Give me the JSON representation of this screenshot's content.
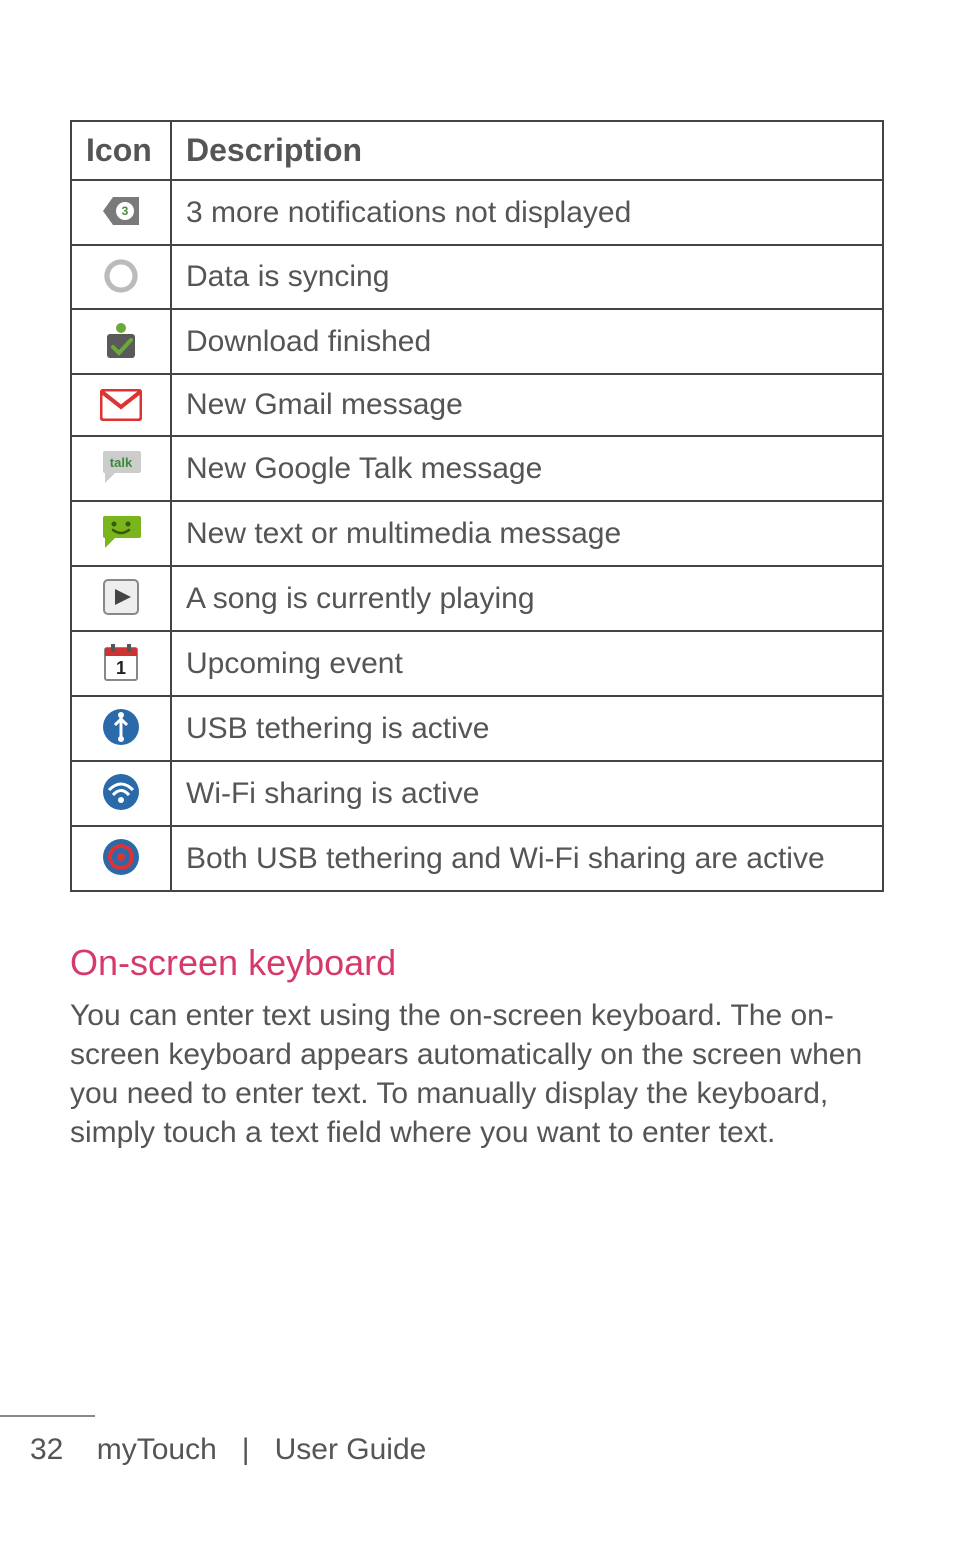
{
  "table": {
    "headers": {
      "icon": "Icon",
      "description": "Description"
    },
    "rows": [
      {
        "icon_name": "more-notifications-icon",
        "description": "3 more notifications not displayed"
      },
      {
        "icon_name": "sync-icon",
        "description": "Data is syncing"
      },
      {
        "icon_name": "download-finished-icon",
        "description": "Download finished"
      },
      {
        "icon_name": "gmail-icon",
        "description": "New Gmail message"
      },
      {
        "icon_name": "google-talk-icon",
        "description": "New Google Talk message"
      },
      {
        "icon_name": "sms-mms-icon",
        "description": "New text or multimedia message"
      },
      {
        "icon_name": "music-playing-icon",
        "description": "A song is currently playing"
      },
      {
        "icon_name": "calendar-event-icon",
        "description": "Upcoming event"
      },
      {
        "icon_name": "usb-tethering-icon",
        "description": "USB tethering is active"
      },
      {
        "icon_name": "wifi-sharing-icon",
        "description": "Wi-Fi sharing is active"
      },
      {
        "icon_name": "usb-wifi-sharing-icon",
        "description": "Both USB tethering and Wi-Fi sharing are active"
      }
    ]
  },
  "section": {
    "title": "On-screen keyboard",
    "body": "You can enter text using the on-screen keyboard. The on-screen keyboard appears automatically on the screen when you need to enter text. To manually display the keyboard, simply touch a text field where you want to enter text."
  },
  "footer": {
    "page_number": "32",
    "product": "myTouch",
    "separator": "|",
    "doc_title": "User Guide"
  }
}
